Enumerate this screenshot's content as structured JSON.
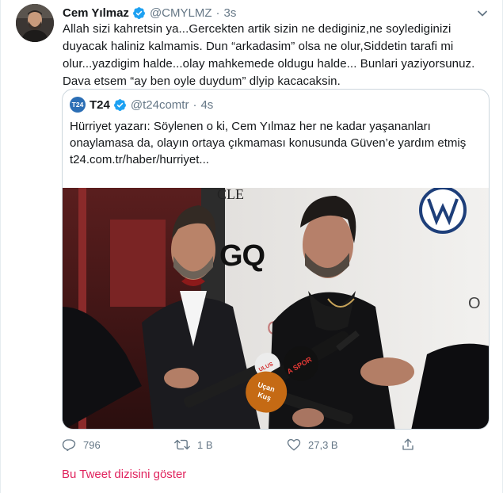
{
  "tweet": {
    "author_name": "Cem Yılmaz",
    "handle": "@CMYLMZ",
    "separator": "·",
    "time": "3s",
    "text": "Allah sizi kahretsin ya...Gercekten artik  sizin ne dediginiz,ne soylediginizi duyacak haliniz kalmamis. Dun “arkadasim” olsa ne olur,Siddetin tarafi mi olur...yazdigim halde...olay mahkemede oldugu halde... Bunlari yaziyorsunuz. Dava etsem “ay ben oyle duydum” dlyip kacacaksin."
  },
  "quote": {
    "avatar_label": "T24",
    "author_name": "T24",
    "handle": "@t24comtr",
    "separator": "·",
    "time": "4s",
    "text": "Hürriyet yazarı: Söylenen o ki, Cem Yılmaz her ne kadar yaşananları onaylamasa da, olayın ortaya çıkmaması konusunda Güven’e yardım etmiş",
    "link": "t24.com.tr/haber/hurriyet..."
  },
  "actions": {
    "reply_count": "796",
    "retweet_count": "1 B",
    "like_count": "27,3 B"
  },
  "thread_link": "Bu Tweet dizisini göster",
  "colors": {
    "accent": "#e0245e",
    "verified": "#1da1f2",
    "muted": "#657786",
    "border": "#ccd6dd"
  },
  "icons": {
    "verified": "verified-badge-icon",
    "caret": "chevron-down-icon",
    "reply": "reply-icon",
    "retweet": "retweet-icon",
    "like": "heart-icon",
    "share": "share-icon"
  }
}
